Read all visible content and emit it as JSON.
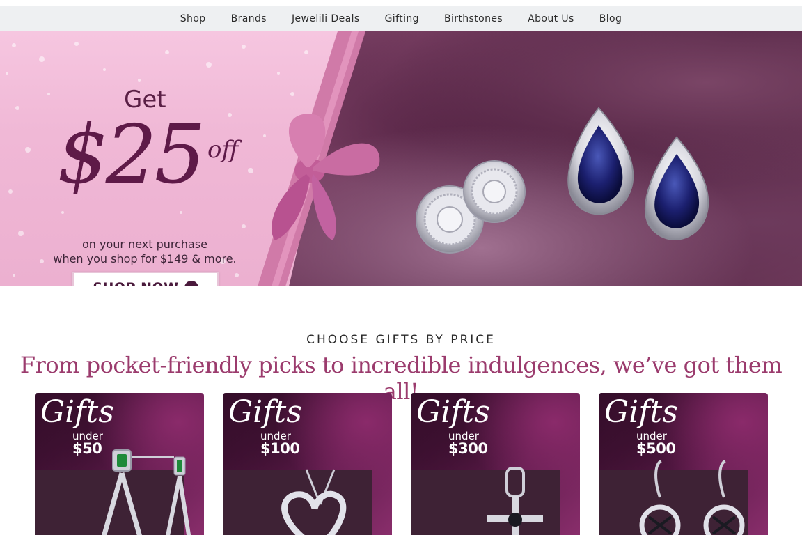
{
  "nav": {
    "items": [
      {
        "label": "Shop"
      },
      {
        "label": "Brands"
      },
      {
        "label": "Jewelili Deals"
      },
      {
        "label": "Gifting"
      },
      {
        "label": "Birthstones"
      },
      {
        "label": "About Us"
      },
      {
        "label": "Blog"
      }
    ]
  },
  "hero": {
    "get": "Get",
    "amount": "$25",
    "off": "off",
    "line1": "on your next purchase",
    "line2": "when you shop for $149 & more.",
    "cta": "SHOP NOW"
  },
  "section": {
    "eyebrow": "CHOOSE GIFTS BY PRICE",
    "headline": "From pocket-friendly picks to incredible indulgences, we’ve got them all!"
  },
  "cards": [
    {
      "script": "Gifts",
      "under": "under",
      "price": "$50"
    },
    {
      "script": "Gifts",
      "under": "under",
      "price": "$100"
    },
    {
      "script": "Gifts",
      "under": "under",
      "price": "$300"
    },
    {
      "script": "Gifts",
      "under": "under",
      "price": "$500"
    }
  ],
  "colors": {
    "nav_bg": "#eef0f2",
    "accent": "#9b3b6d",
    "hero_pink": "#f0b8d6",
    "dark_plum": "#5e1a48"
  },
  "icons": {
    "cta_arrow": "arrow-circle-right-icon"
  }
}
